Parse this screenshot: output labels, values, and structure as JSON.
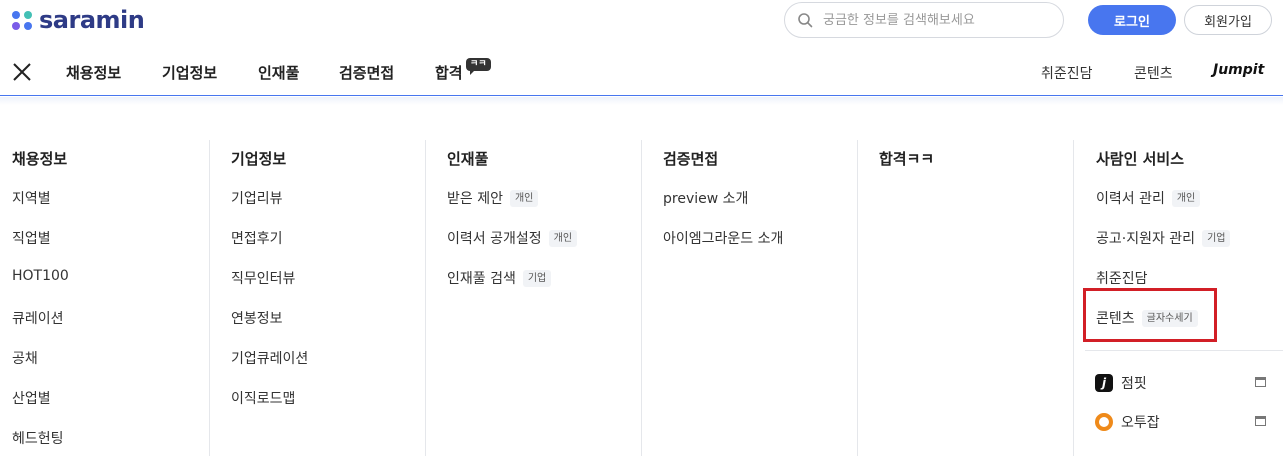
{
  "brand": {
    "name": "saramin",
    "dot_colors": [
      "#4876ef",
      "#43c0b5",
      "#7b5ce8",
      "#4876ef"
    ]
  },
  "header": {
    "search_placeholder": "궁금한 정보를 검색해보세요",
    "login_label": "로그인",
    "signup_label": "회원가입"
  },
  "nav": {
    "items": [
      "채용정보",
      "기업정보",
      "인재풀",
      "검증면접",
      "합격"
    ],
    "hap_badge": "ㅋㅋ",
    "right": [
      "취준진담",
      "콘텐츠"
    ],
    "jumpit_label": "Jumpit"
  },
  "menu": {
    "columns": [
      {
        "title": "채용정보",
        "links": [
          {
            "label": "지역별"
          },
          {
            "label": "직업별"
          },
          {
            "label": "HOT100"
          },
          {
            "label": "큐레이션"
          },
          {
            "label": "공채"
          },
          {
            "label": "산업별"
          },
          {
            "label": "헤드헌팅"
          }
        ]
      },
      {
        "title": "기업정보",
        "links": [
          {
            "label": "기업리뷰"
          },
          {
            "label": "면접후기"
          },
          {
            "label": "직무인터뷰"
          },
          {
            "label": "연봉정보"
          },
          {
            "label": "기업큐레이션"
          },
          {
            "label": "이직로드맵"
          }
        ]
      },
      {
        "title": "인재풀",
        "links": [
          {
            "label": "받은 제안",
            "tag": "개인"
          },
          {
            "label": "이력서 공개설정",
            "tag": "개인"
          },
          {
            "label": "인재풀 검색",
            "tag": "기업"
          }
        ]
      },
      {
        "title": "검증면접",
        "links": [
          {
            "label": "preview 소개"
          },
          {
            "label": "아이엠그라운드 소개"
          }
        ]
      },
      {
        "title": "합격ㅋㅋ",
        "links": []
      },
      {
        "title": "사람인 서비스",
        "links": [
          {
            "label": "이력서 관리",
            "tag": "개인"
          },
          {
            "label": "공고·지원자 관리",
            "tag": "기업"
          },
          {
            "label": "취준진담"
          },
          {
            "label": "콘텐츠",
            "tag": "글자수세기"
          }
        ]
      }
    ],
    "external_services": [
      {
        "label": "점핏",
        "icon": "jumpit-logo-icon"
      },
      {
        "label": "오투잡",
        "icon": "otwojob-logo-icon"
      }
    ]
  },
  "colors": {
    "accent": "#4876ef",
    "highlight": "#d21f26",
    "logo_text": "#2e3b86"
  }
}
